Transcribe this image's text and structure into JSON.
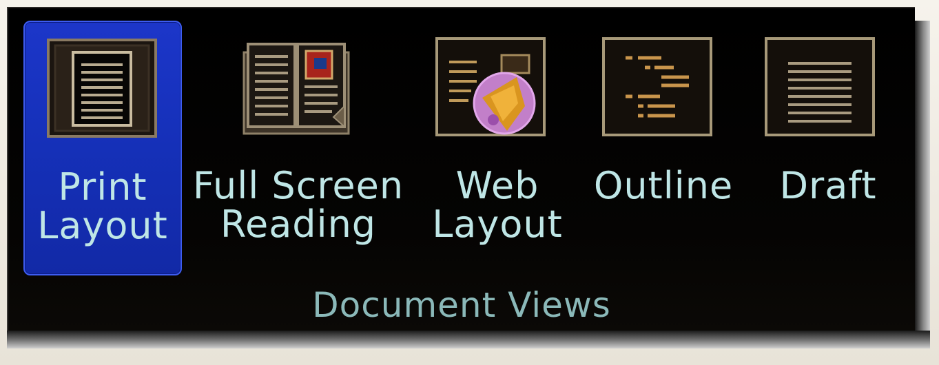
{
  "ribbon_group": {
    "title": "Document Views",
    "buttons": [
      {
        "line1": "Print",
        "line2": "Layout",
        "icon": "print-layout-icon",
        "selected": true
      },
      {
        "line1": "Full Screen",
        "line2": "Reading",
        "icon": "full-screen-reading-icon",
        "selected": false
      },
      {
        "line1": "Web",
        "line2": "Layout",
        "icon": "web-layout-icon",
        "selected": false
      },
      {
        "line1": "Outline",
        "line2": "",
        "icon": "outline-icon",
        "selected": false
      },
      {
        "line1": "Draft",
        "line2": "",
        "icon": "draft-icon",
        "selected": false
      }
    ]
  },
  "colors": {
    "selected_bg": "#1a33c4",
    "label_text": "#bfe6e6",
    "group_bg": "#000000"
  }
}
